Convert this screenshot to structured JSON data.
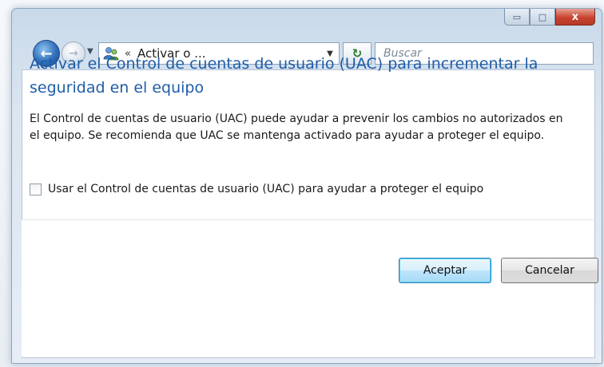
{
  "window": {
    "caption_buttons": {
      "minimize_icon": "minimize-icon",
      "maximize_icon": "maximize-icon",
      "close_glyph": "x"
    }
  },
  "navigation": {
    "address_separator": "«",
    "address_text": "Activar o ...",
    "search_placeholder": "Buscar",
    "back_glyph": "←",
    "forward_glyph": "→",
    "refresh_glyph": "↻"
  },
  "dialog": {
    "title": "Activar el Control de cuentas de usuario (UAC) para incrementar la seguridad en el equipo",
    "description": "El Control de cuentas de usuario (UAC) puede ayudar a prevenir los cambios no autorizados en el equipo. Se recomienda que UAC se mantenga activado para ayudar a proteger el equipo.",
    "checkbox_label": "Usar el Control de cuentas de usuario (UAC) para ayudar a proteger el equipo",
    "checkbox_checked": false,
    "ok_label": "Aceptar",
    "cancel_label": "Cancelar"
  },
  "colors": {
    "title": "#1f5ca8",
    "close_button": "#c8442f",
    "default_button_border": "#3c7fb1"
  }
}
